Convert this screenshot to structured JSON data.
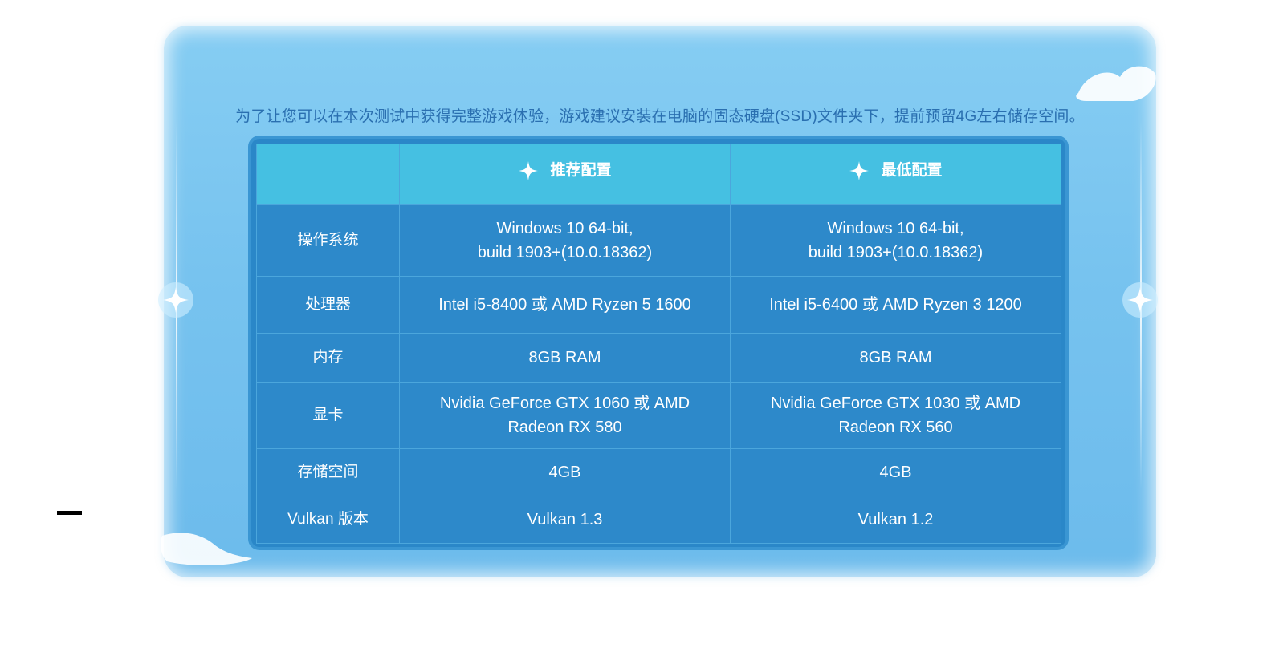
{
  "intro_text": "为了让您可以在本次测试中获得完整游戏体验，游戏建议安装在电脑的固态硬盘(SSD)文件夹下，提前预留4G左右储存空间。",
  "table": {
    "columns": [
      {
        "label": "推荐配置",
        "icon": "sparkle-icon"
      },
      {
        "label": "最低配置",
        "icon": "sparkle-icon"
      }
    ],
    "rows": [
      {
        "label": "操作系统",
        "recommended": [
          "Windows 10 64-bit,",
          "build 1903+(10.0.18362)"
        ],
        "minimum": [
          "Windows 10 64-bit,",
          "build 1903+(10.0.18362)"
        ]
      },
      {
        "label": "处理器",
        "recommended": [
          "Intel i5-8400 或 AMD Ryzen 5 1600"
        ],
        "minimum": [
          "Intel i5-6400 或 AMD Ryzen 3 1200"
        ]
      },
      {
        "label": "内存",
        "recommended": [
          "8GB RAM"
        ],
        "minimum": [
          "8GB RAM"
        ]
      },
      {
        "label": "显卡",
        "recommended": [
          "Nvidia GeForce GTX 1060 或 AMD",
          "Radeon RX 580"
        ],
        "minimum": [
          "Nvidia GeForce GTX 1030 或 AMD",
          "Radeon RX 560"
        ]
      },
      {
        "label": "存储空间",
        "recommended": [
          "4GB"
        ],
        "minimum": [
          "4GB"
        ]
      },
      {
        "label": "Vulkan 版本",
        "recommended": [
          "Vulkan 1.3"
        ],
        "minimum": [
          "Vulkan 1.2"
        ]
      }
    ]
  },
  "colors": {
    "panel": "#7ac6f0",
    "header_cell": "#45c0e2",
    "body_cell": "#2d89ca",
    "intro_text": "#2a6fb0"
  }
}
